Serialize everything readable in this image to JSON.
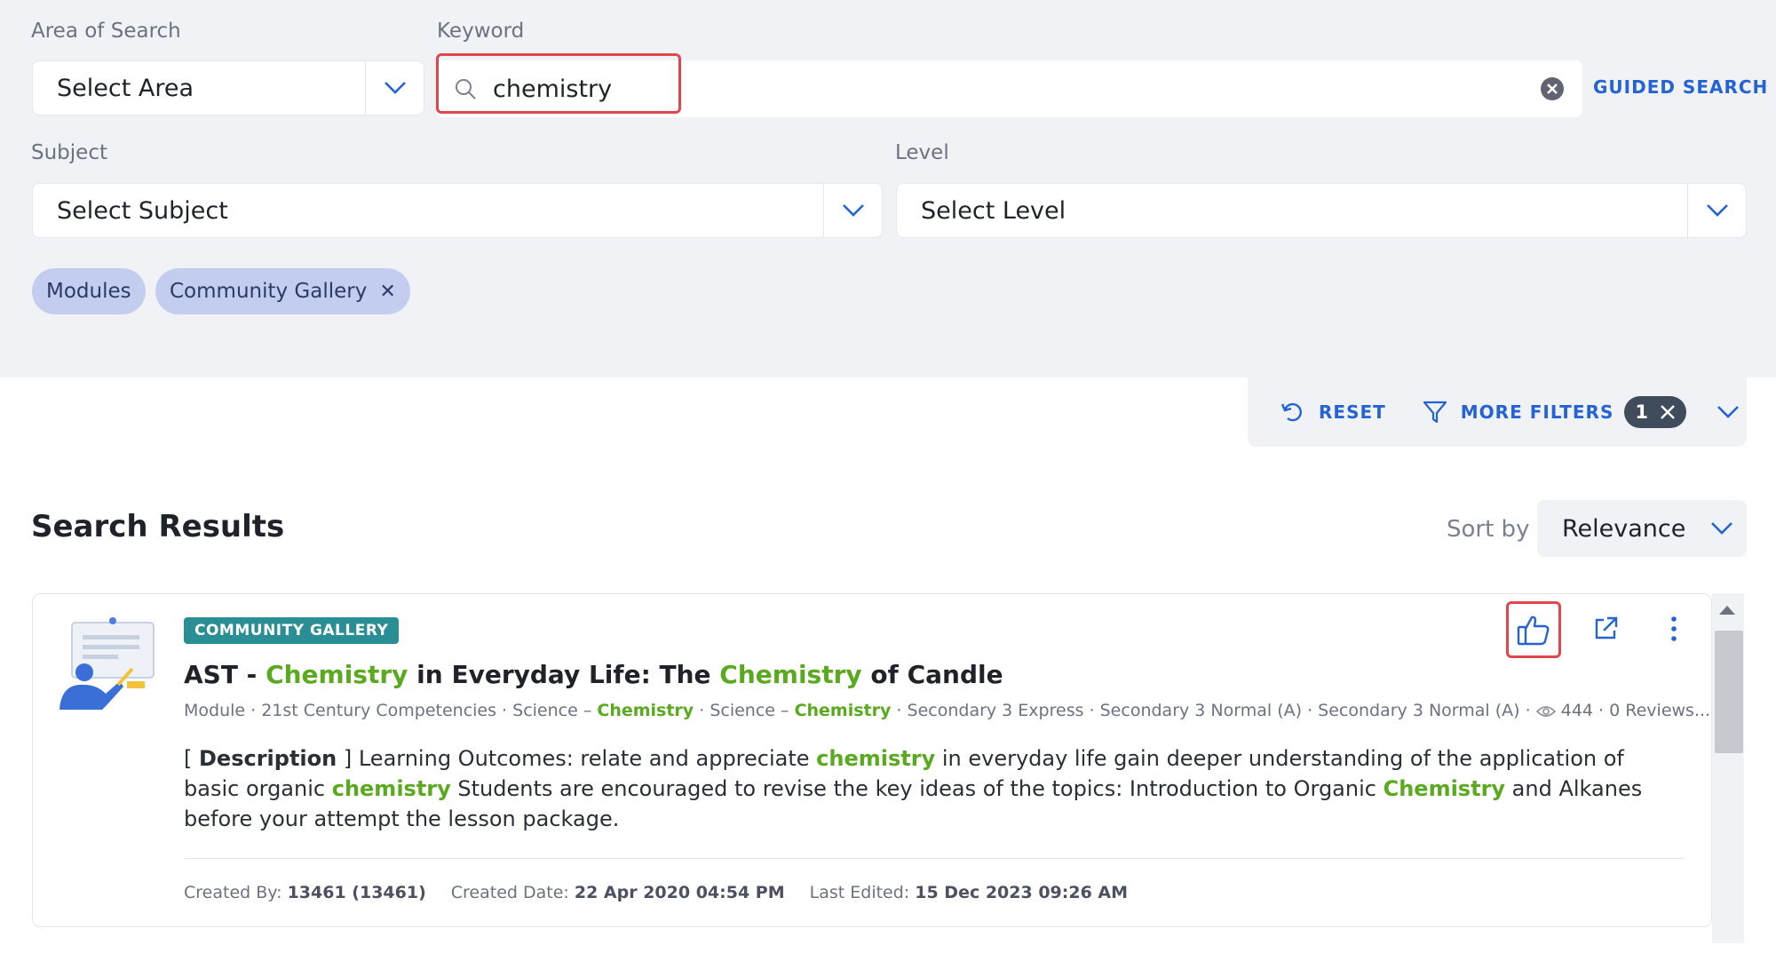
{
  "filters": {
    "area_label": "Area of Search",
    "area_value": "Select Area",
    "keyword_label": "Keyword",
    "keyword_value": "chemistry",
    "guided_search": "GUIDED SEARCH",
    "subject_label": "Subject",
    "subject_value": "Select Subject",
    "level_label": "Level",
    "level_value": "Select Level",
    "chips": [
      {
        "label": "Modules",
        "removable": false
      },
      {
        "label": "Community Gallery",
        "removable": true
      }
    ]
  },
  "filter_bar": {
    "reset": "RESET",
    "more_filters": "MORE FILTERS",
    "count": "1"
  },
  "results": {
    "title": "Search Results",
    "sort_label": "Sort by",
    "sort_value": "Relevance"
  },
  "card": {
    "badge": "COMMUNITY GALLERY",
    "title_parts": [
      "AST - ",
      "Chemistry",
      " in Everyday Life: The ",
      "Chemistry",
      " of Candle"
    ],
    "meta": {
      "type": "Module",
      "competency": "21st Century Competencies",
      "subject1_prefix": "Science – ",
      "subject1_topic": "Chemistry",
      "subject2_prefix": "Science – ",
      "subject2_topic": "Chemistry",
      "level1": "Secondary 3 Express",
      "level2": "Secondary 3 Normal (A)",
      "level3": "Secondary 3 Normal (A)",
      "views": "444",
      "reviews": "0 Reviews..."
    },
    "description_parts": [
      "[ ",
      "Description",
      " ] Learning Outcomes: relate and appreciate ",
      "chemistry",
      " in everyday life gain deeper understanding of the application of basic organic ",
      "chemistry",
      " Students are encouraged to revise the key ideas of the topics: Introduction to Organic ",
      "Chemistry",
      " and Alkanes before your attempt the lesson package."
    ],
    "created_by_label": "Created By:",
    "created_by": "13461 (13461)",
    "created_date_label": "Created Date:",
    "created_date": "22 Apr 2020 04:54 PM",
    "last_edited_label": "Last Edited:",
    "last_edited": "15 Dec 2023 09:26 AM"
  },
  "colors": {
    "accent": "#2463d6",
    "highlight": "#5aaa1f",
    "badge": "#2a8f94",
    "focus_outline": "#e0474c",
    "chip": "#c3cdf0"
  },
  "icons": [
    "chevron-down-icon",
    "search-icon",
    "clear-icon",
    "close-icon",
    "reset-icon",
    "filter-icon",
    "thumbs-up-icon",
    "external-link-icon",
    "more-vertical-icon",
    "eye-icon"
  ]
}
